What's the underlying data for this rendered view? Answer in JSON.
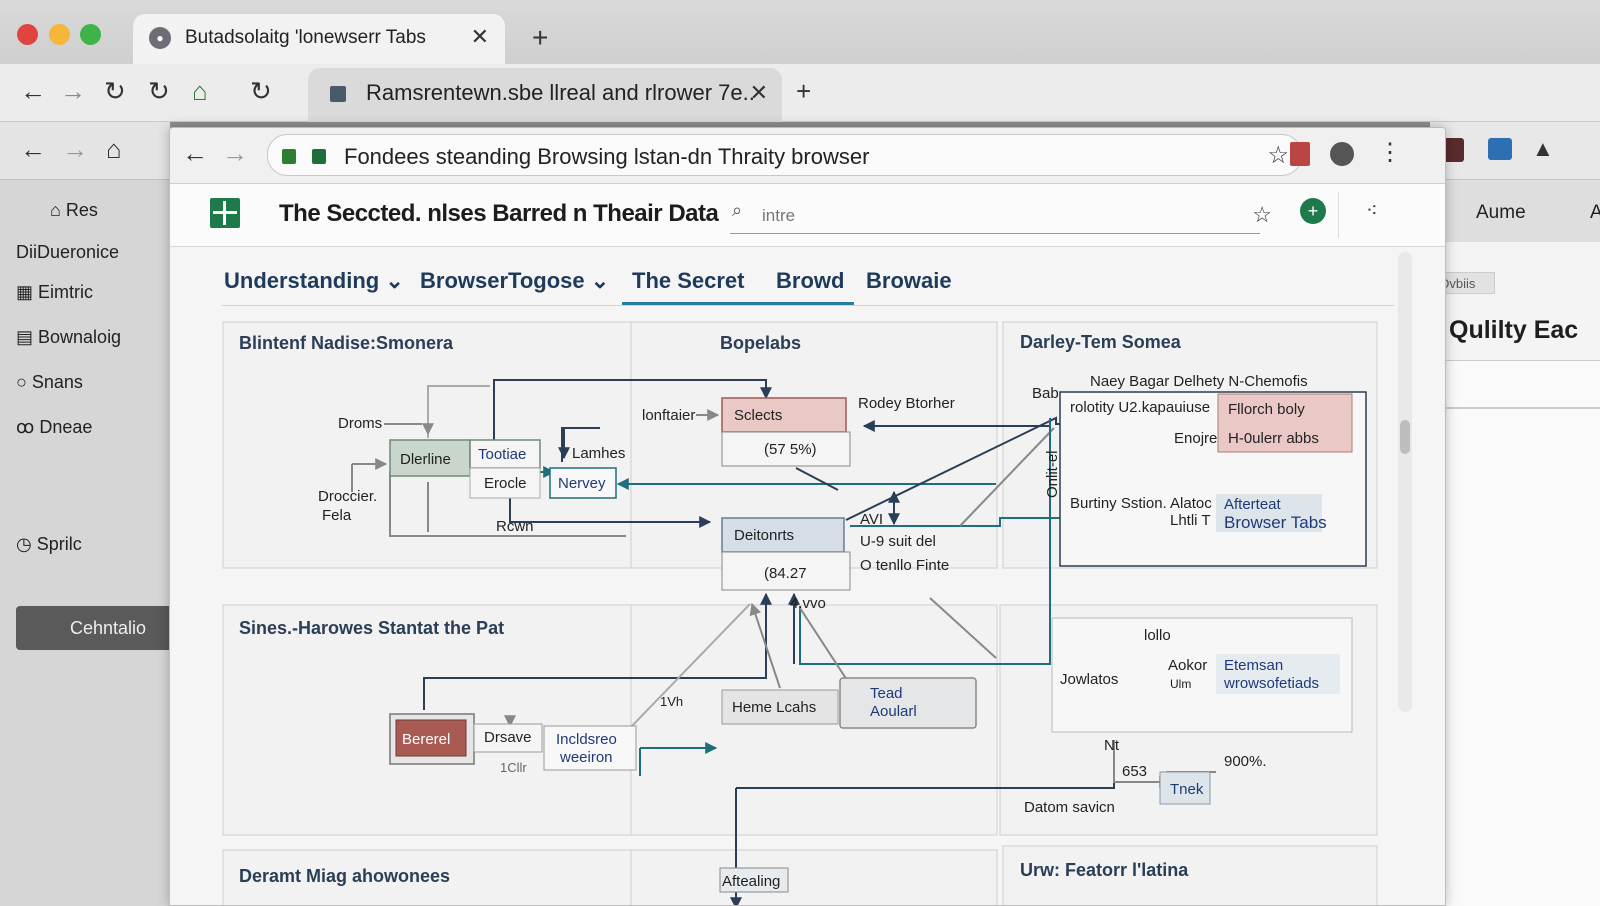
{
  "outer_tab": {
    "title": "Butadsolaitg 'lonewserr Tabs",
    "close": "✕",
    "new_tab": "+"
  },
  "second_tab": {
    "title": "Ramsrentewn.sbe llreal and rlrower 7e..",
    "close": "✕",
    "new_tab": "+"
  },
  "behind_left": {
    "items": [
      "Res",
      "DiiDueronice",
      "Eimtric",
      "Bownaloig",
      "Snans",
      "Dneae"
    ],
    "active_item": "Cehntalio",
    "last_item": "Sprilc"
  },
  "behind_right": {
    "label1": "Aume",
    "label2": "A",
    "tag": "Dvbiis",
    "heading": "Qulilty Eac"
  },
  "front": {
    "url": "Fondees steanding Browsing lstan-dn Thraity browser",
    "app_title": "The Seccted. nlses Barred n Theair Data",
    "search_placeholder": "intre",
    "tabs": [
      "Understanding",
      "BrowserTogose",
      "The Secret",
      "Browd",
      "Browaie"
    ]
  },
  "diagram": {
    "sections": {
      "top_left": "Blintenf Nadise:Smonera",
      "top_middle": "Bopelabs",
      "top_right": "Darley-Tem Somea",
      "bottom_left": "Sines.-Harowes Stantat the Pat",
      "footer_left": "Deramt Miag ahowonees",
      "footer_right": "Urw: Featorr l'latina"
    },
    "labels": {
      "droms": "Droms",
      "droccier": "Droccier.",
      "fela": "Fela",
      "dlerline": "Dlerline",
      "tootiae": "Tootiae",
      "erocle": "Erocle",
      "lamhes": "Lamhes",
      "nervey": "Nervey",
      "rcwn": "Rcwn",
      "lonftaier": "lonftaier",
      "sclects": "Sclects",
      "pct1": "(57 5%)",
      "rodey": "Rodey Btorher",
      "deitonrts": "Deitonrts",
      "val2": "(84.27",
      "avi": "AVI",
      "suitdel": "U-9 suit del",
      "otenllo": "O tenllo Finte",
      "avvo": "4.vvo",
      "naey": "Naey Bagar Delhety N-Chemofis",
      "bab": "Bab",
      "rolotity": "rolotity U2.kapauiuse",
      "fllorch": "Fllorch boly",
      "enojre": "Enojre",
      "houlerr": "H-0ulerr abbs",
      "onlitel": "Onlit-el",
      "burtiny": "Burtiny Sstion. Alatoc",
      "lhtli": "Lhtli T",
      "afterteat": "Afterteat",
      "browser_tabs": "Browser Tabs",
      "lollo": "lollo",
      "aokor": "Aokor",
      "etemsan": "Etemsan",
      "ulm": "Ulm",
      "wrowsofetiads": "wrowsofetiads",
      "jowlatos": "Jowlatos",
      "bererel": "Bererel",
      "drsave": "Drsave",
      "icllr": "1Cllr",
      "incldsreo": "Incldsreo",
      "weeiron": "weeiron",
      "hyph": "1Vh",
      "heme": "Heme Lcahs",
      "tead": "Tead",
      "aoularl": "Aoularl",
      "nt": "Nt",
      "v653": "653",
      "v900": "900%.",
      "tnek": "Tnek",
      "datom": "Datom savicn",
      "aftealing": "Aftealing"
    }
  }
}
